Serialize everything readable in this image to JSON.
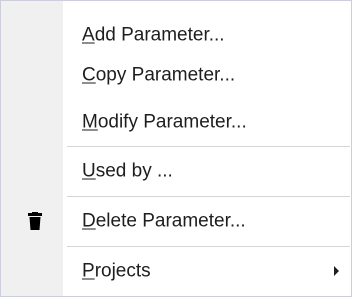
{
  "menu": {
    "items": [
      {
        "accel": "A",
        "rest": "dd Parameter..."
      },
      {
        "accel": "C",
        "rest": "opy Parameter..."
      },
      {
        "accel": "M",
        "rest": "odify Parameter..."
      },
      {
        "accel": "U",
        "rest": "sed by ..."
      },
      {
        "accel": "D",
        "rest": "elete Parameter...",
        "icon": "trash-icon"
      },
      {
        "accel": "P",
        "rest": "rojects",
        "submenu_icon": "submenu-arrow-icon"
      }
    ]
  },
  "colors": {
    "background": "#ffffff",
    "gutter": "#f0f0f0",
    "text": "#1e1e1e",
    "separator": "#d5d5d5",
    "border": "#cccedb"
  }
}
